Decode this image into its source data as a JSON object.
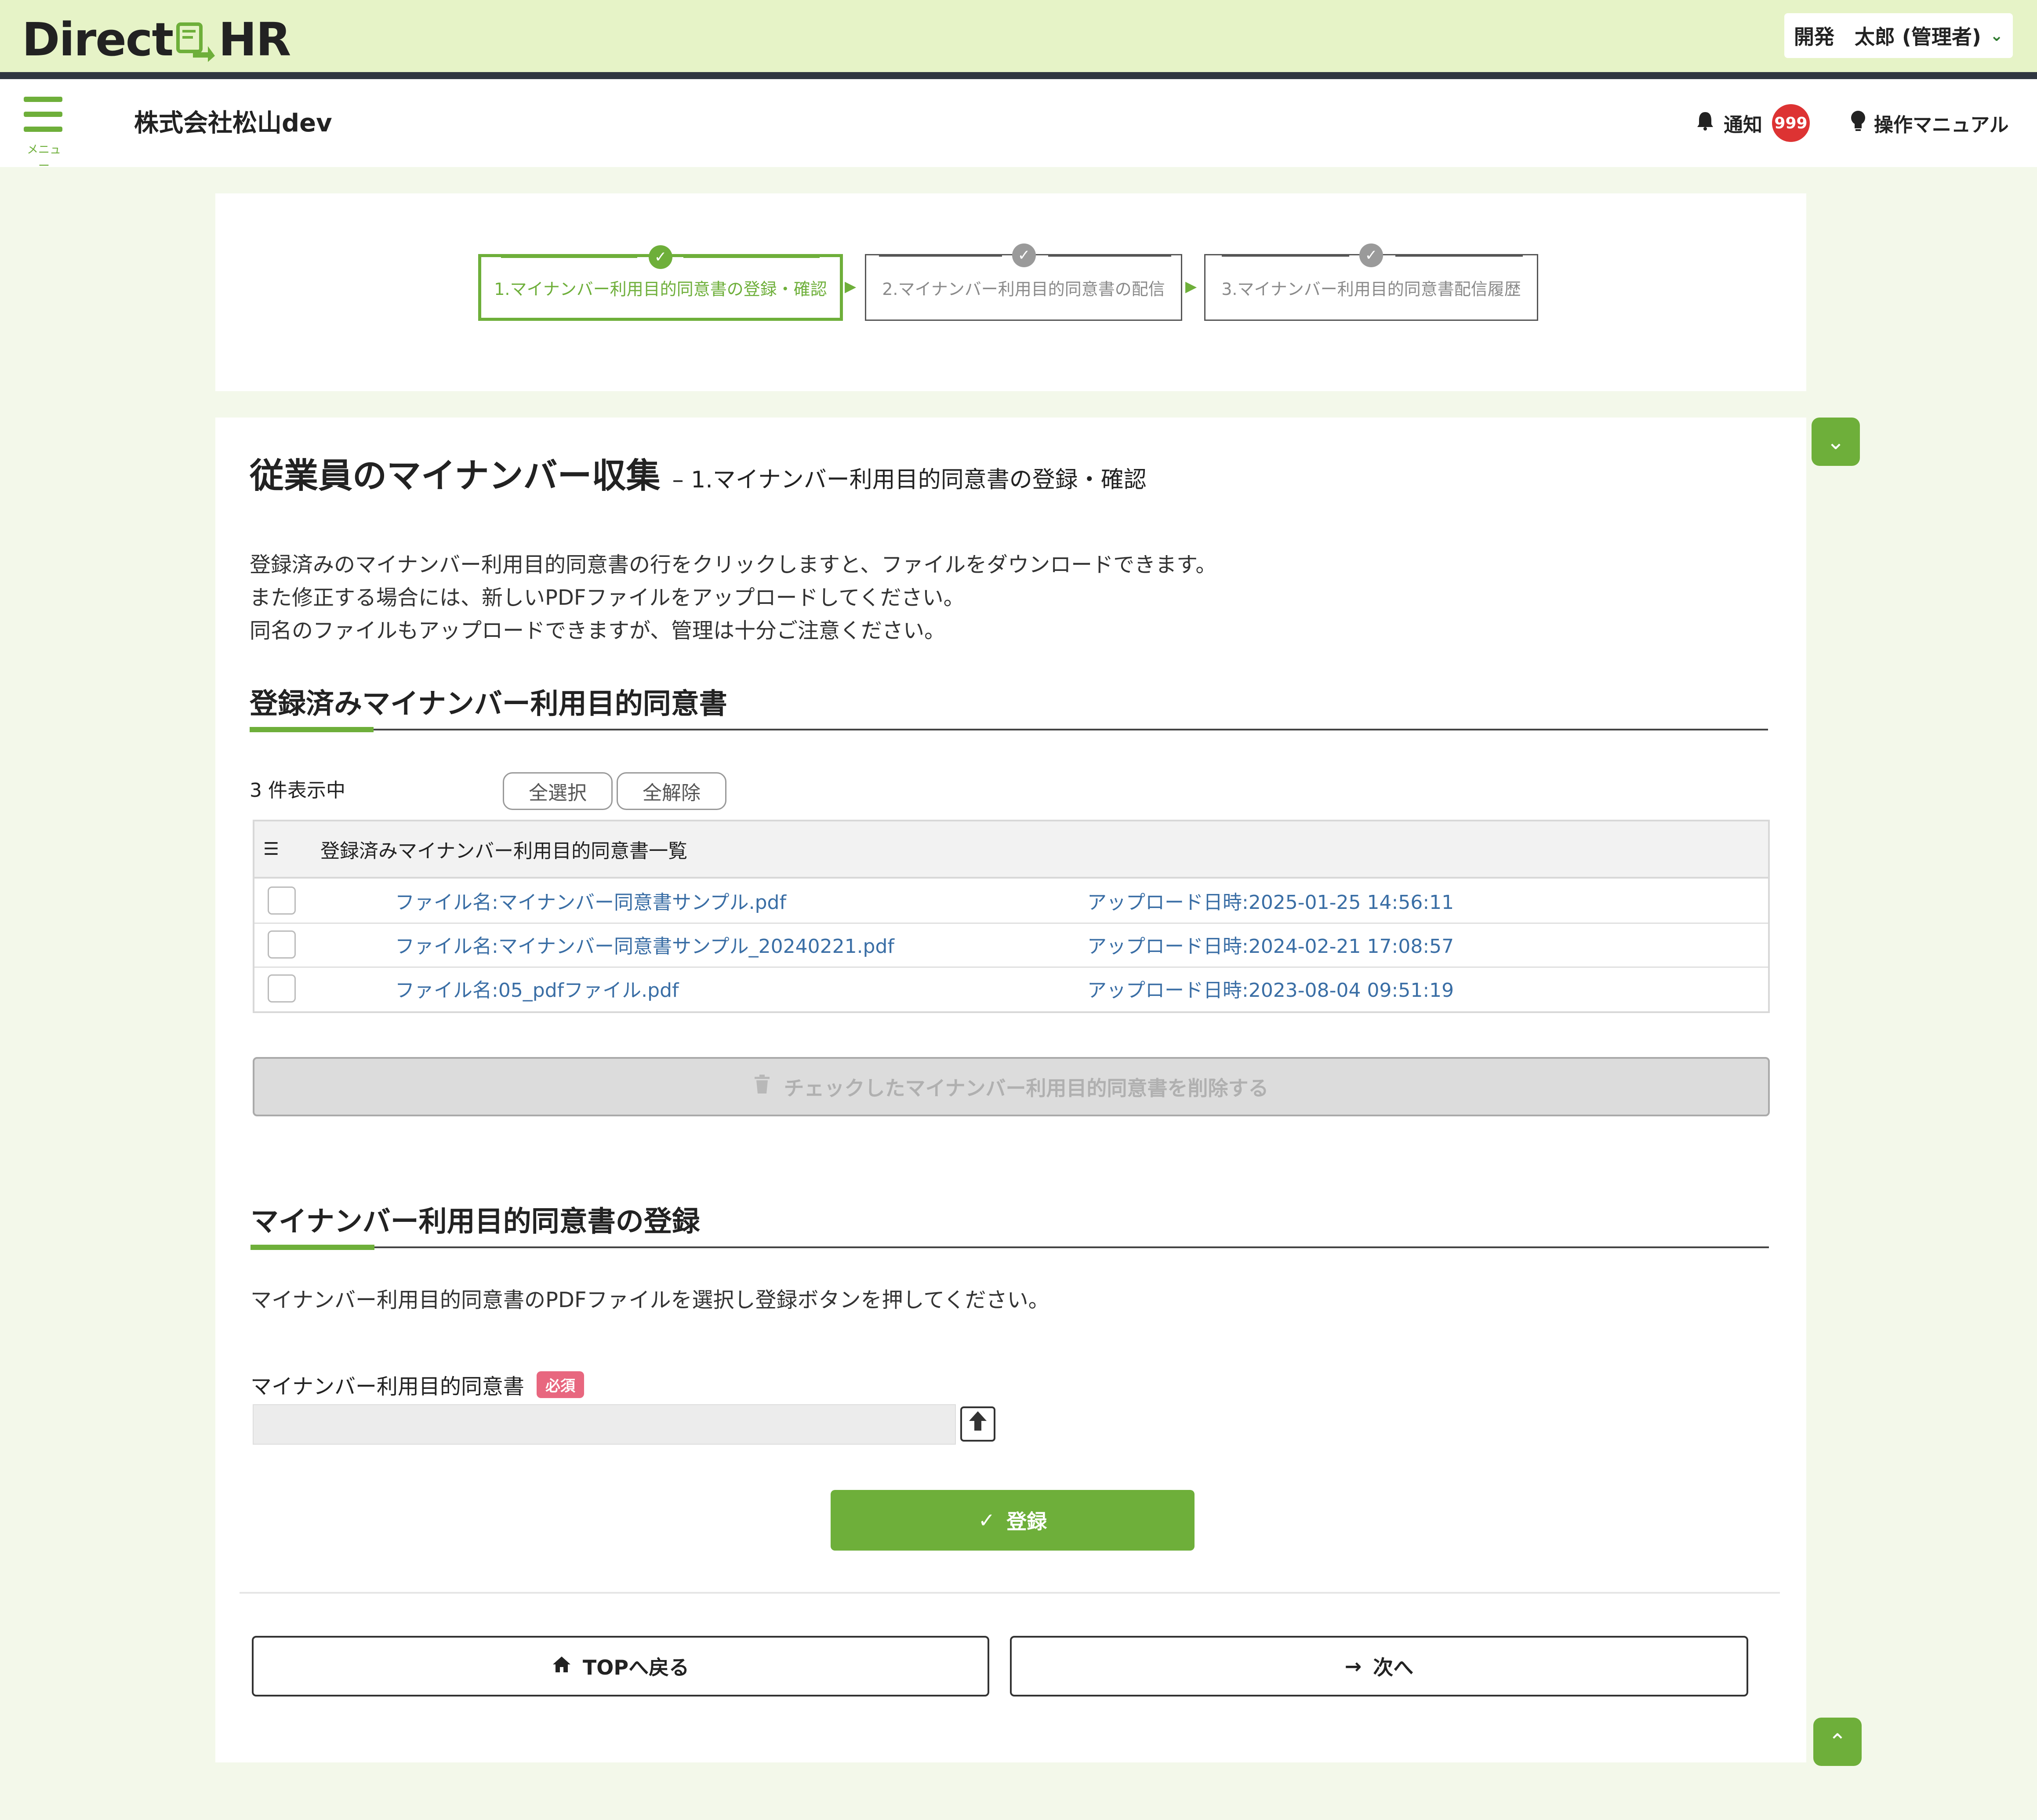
{
  "brand": {
    "name_left": "Direct",
    "name_right": "HR"
  },
  "user": {
    "name": "開発　太郎 (管理者)"
  },
  "header": {
    "menu_label": "メニュー",
    "company": "株式会社松山dev",
    "notification_label": "通知",
    "notification_count": "999",
    "manual_label": "操作マニュアル"
  },
  "steps": [
    {
      "label": "1.マイナンバー利用目的同意書の登録・確認",
      "state": "active"
    },
    {
      "label": "2.マイナンバー利用目的同意書の配信",
      "state": "inactive"
    },
    {
      "label": "3.マイナンバー利用目的同意書配信履歴",
      "state": "inactive"
    }
  ],
  "page": {
    "title": "従業員のマイナンバー収集",
    "subtitle": "– 1.マイナンバー利用目的同意書の登録・確認",
    "description": [
      "登録済みのマイナンバー利用目的同意書の行をクリックしますと、ファイルをダウンロードできます。",
      "また修正する場合には、新しいPDFファイルをアップロードしてください。",
      "同名のファイルもアップロードできますが、管理は十分ご注意ください。"
    ]
  },
  "registered": {
    "section_title": "登録済みマイナンバー利用目的同意書",
    "count_text": "3 件表示中",
    "select_all": "全選択",
    "deselect_all": "全解除",
    "table_title": "登録済みマイナンバー利用目的同意書一覧",
    "rows": [
      {
        "file": "ファイル名:マイナンバー同意書サンプル.pdf",
        "date": "アップロード日時:2025-01-25 14:56:11",
        "checked": false
      },
      {
        "file": "ファイル名:マイナンバー同意書サンプル_20240221.pdf",
        "date": "アップロード日時:2024-02-21 17:08:57",
        "checked": false
      },
      {
        "file": "ファイル名:05_pdfファイル.pdf",
        "date": "アップロード日時:2023-08-04 09:51:19",
        "checked": false
      }
    ],
    "delete_button": "チェックしたマイナンバー利用目的同意書を削除する"
  },
  "registration": {
    "section_title": "マイナンバー利用目的同意書の登録",
    "description": "マイナンバー利用目的同意書のPDFファイルを選択し登録ボタンを押してください。",
    "field_label": "マイナンバー利用目的同意書",
    "required_badge": "必須",
    "file_value": "",
    "register_button": "登録"
  },
  "footer": {
    "back_button": "TOPへ戻る",
    "next_button": "次へ"
  },
  "colors": {
    "accent": "#6eaf3a",
    "brand_bg": "#e6f3c7",
    "badge": "#d33333",
    "required": "#e8677f",
    "link": "#3a6ea5"
  },
  "icons": {
    "menu": "hamburger-icon",
    "bell": "bell-icon",
    "bulb": "lightbulb-icon",
    "check": "check-icon",
    "trash": "trash-icon",
    "upload": "upload-icon",
    "home": "home-icon",
    "arrow": "arrow-right-icon",
    "chevron_down": "chevron-down-icon",
    "chevron_up": "chevron-up-icon"
  }
}
